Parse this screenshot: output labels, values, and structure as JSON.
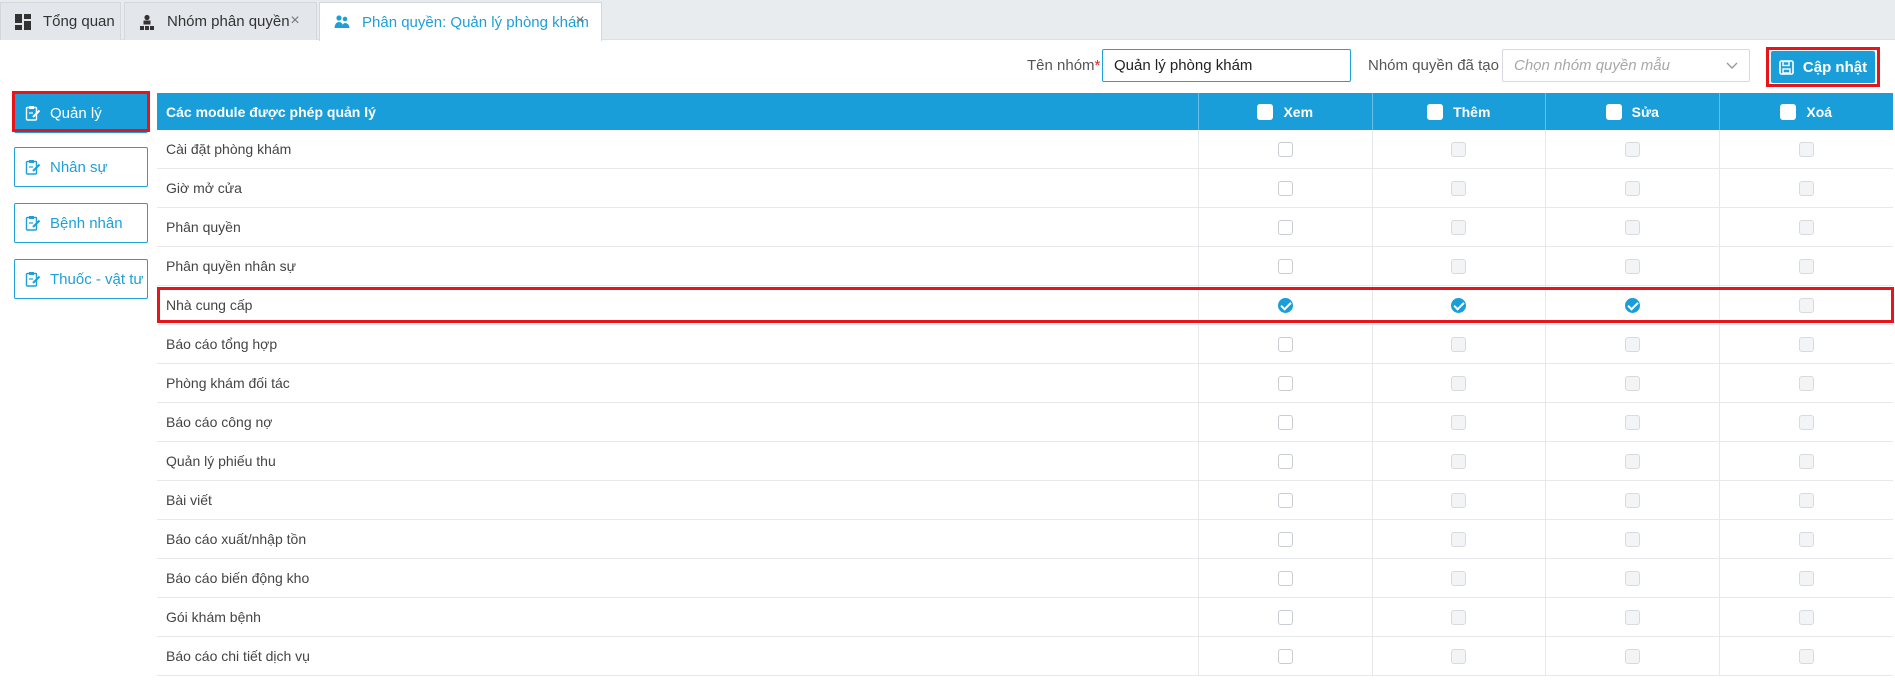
{
  "tabs": [
    {
      "label": "Tổng quan",
      "icon": "dashboard-icon",
      "closable": false,
      "active": false
    },
    {
      "label": "Nhóm phân quyền",
      "icon": "org-chart-icon",
      "closable": true,
      "active": false
    },
    {
      "label": "Phân quyền: Quản lý phòng khám",
      "icon": "users-icon",
      "closable": true,
      "active": true
    }
  ],
  "form": {
    "group_name_label": "Tên nhóm",
    "group_name_required": "*",
    "group_name_value": "Quản lý phòng khám",
    "template_label": "Nhóm quyền đã tạo :",
    "template_placeholder": "Chọn nhóm quyền mẫu",
    "update_button": "Cập nhật"
  },
  "nav": [
    {
      "label": "Quản lý",
      "active": true
    },
    {
      "label": "Nhân sự",
      "active": false
    },
    {
      "label": "Bệnh nhân",
      "active": false
    },
    {
      "label": "Thuốc - vật tư",
      "active": false
    }
  ],
  "table": {
    "module_header": "Các module được phép quản lý",
    "permission_headers": [
      "Xem",
      "Thêm",
      "Sửa",
      "Xoá"
    ],
    "rows": [
      {
        "name": "Cài đặt phòng khám",
        "perms": [
          false,
          false,
          false,
          false
        ]
      },
      {
        "name": "Giờ mở cửa",
        "perms": [
          false,
          false,
          false,
          false
        ]
      },
      {
        "name": "Phân quyền",
        "perms": [
          false,
          false,
          false,
          false
        ]
      },
      {
        "name": "Phân quyền nhân sự",
        "perms": [
          false,
          false,
          false,
          false
        ]
      },
      {
        "name": "Nhà cung cấp",
        "perms": [
          true,
          true,
          true,
          false
        ]
      },
      {
        "name": "Báo cáo tổng hợp",
        "perms": [
          false,
          false,
          false,
          false
        ]
      },
      {
        "name": "Phòng khám đối tác",
        "perms": [
          false,
          false,
          false,
          false
        ]
      },
      {
        "name": "Báo cáo công nợ",
        "perms": [
          false,
          false,
          false,
          false
        ]
      },
      {
        "name": "Quản lý phiếu thu",
        "perms": [
          false,
          false,
          false,
          false
        ]
      },
      {
        "name": "Bài viết",
        "perms": [
          false,
          false,
          false,
          false
        ]
      },
      {
        "name": "Báo cáo xuất/nhập tồn",
        "perms": [
          false,
          false,
          false,
          false
        ]
      },
      {
        "name": "Báo cáo biến động kho",
        "perms": [
          false,
          false,
          false,
          false
        ]
      },
      {
        "name": "Gói khám bệnh",
        "perms": [
          false,
          false,
          false,
          false
        ]
      },
      {
        "name": "Báo cáo chi tiết dịch vụ",
        "perms": [
          false,
          false,
          false,
          false
        ]
      }
    ]
  },
  "colors": {
    "accent": "#1a9ed9",
    "highlight": "#e8141c"
  }
}
